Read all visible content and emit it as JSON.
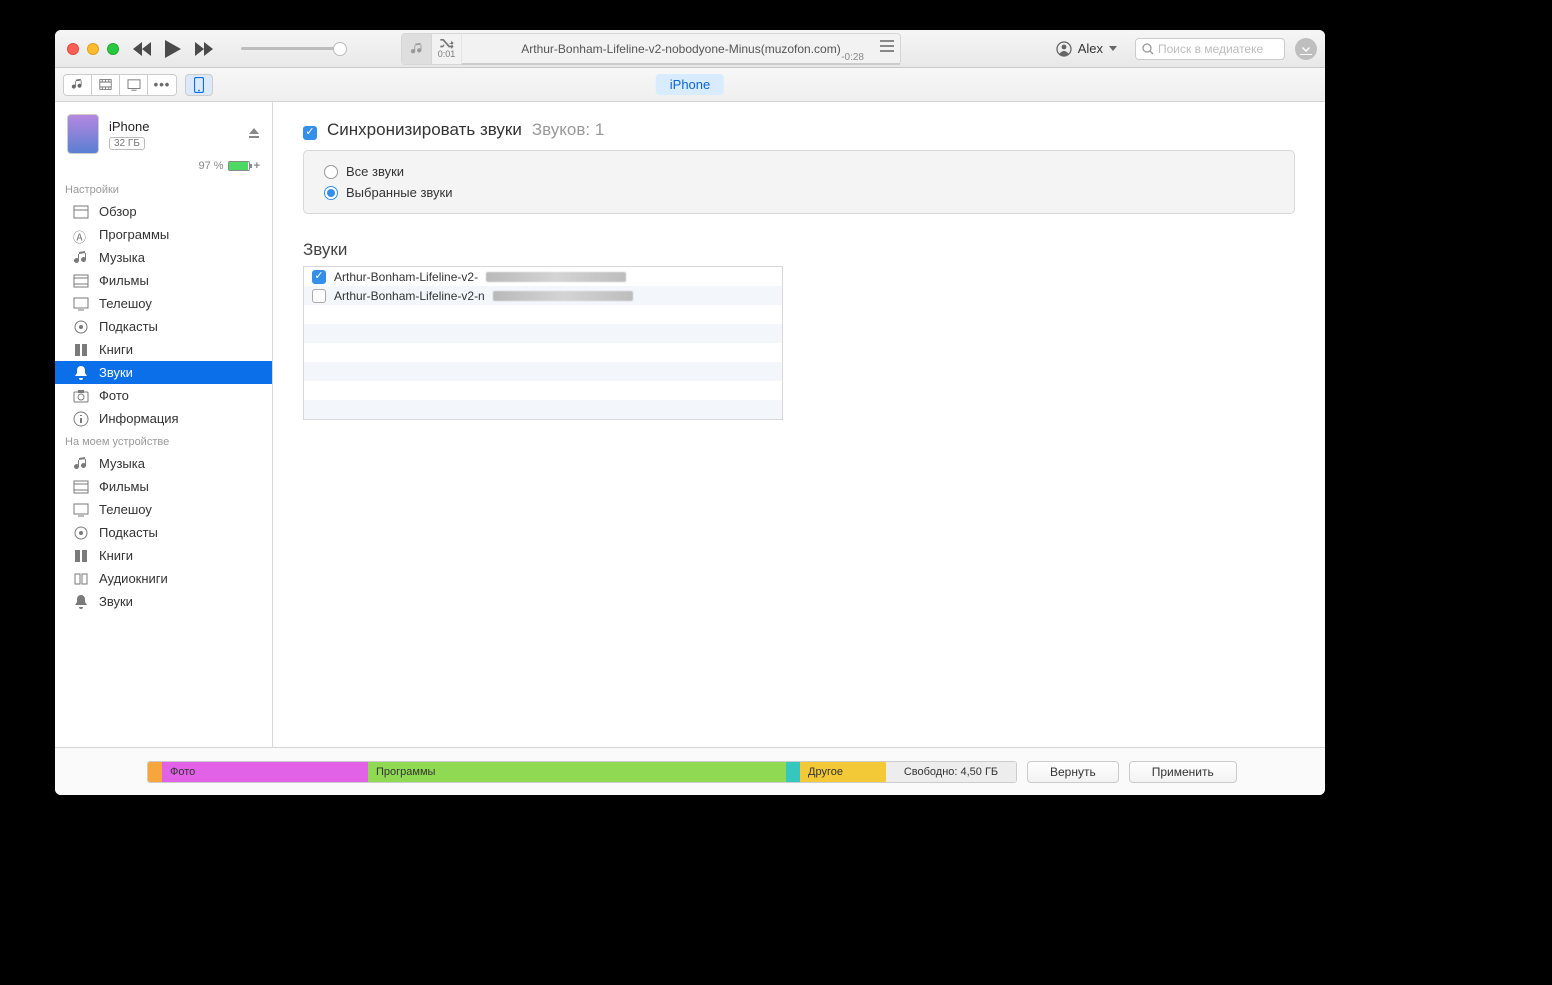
{
  "nowplaying": {
    "title": "Arthur-Bonham-Lifeline-v2-nobodyone-Minus(muzofon.com)",
    "time_elapsed": "0:01",
    "time_remaining": "-0:28"
  },
  "account": {
    "user": "Alex"
  },
  "search": {
    "placeholder": "Поиск в медиатеке"
  },
  "toolbar": {
    "tab": "iPhone"
  },
  "device": {
    "name": "iPhone",
    "capacity": "32 ГБ",
    "battery": "97 %"
  },
  "sidebar": {
    "section_settings": "Настройки",
    "section_device": "На моем устройстве",
    "settings": [
      {
        "label": "Обзор"
      },
      {
        "label": "Программы"
      },
      {
        "label": "Музыка"
      },
      {
        "label": "Фильмы"
      },
      {
        "label": "Телешоу"
      },
      {
        "label": "Подкасты"
      },
      {
        "label": "Книги"
      },
      {
        "label": "Звуки"
      },
      {
        "label": "Фото"
      },
      {
        "label": "Информация"
      }
    ],
    "ondevice": [
      {
        "label": "Музыка"
      },
      {
        "label": "Фильмы"
      },
      {
        "label": "Телешоу"
      },
      {
        "label": "Подкасты"
      },
      {
        "label": "Книги"
      },
      {
        "label": "Аудиокниги"
      },
      {
        "label": "Звуки"
      }
    ]
  },
  "main": {
    "sync_title": "Синхронизировать звуки",
    "count_label": "Звуков: 1",
    "opt_all": "Все звуки",
    "opt_selected": "Выбранные звуки",
    "list_header": "Звуки",
    "items": [
      {
        "label": "Arthur-Bonham-Lifeline-v2-",
        "checked": true
      },
      {
        "label": "Arthur-Bonham-Lifeline-v2-n",
        "checked": false
      }
    ]
  },
  "footer": {
    "photo": "Фото",
    "programs": "Программы",
    "other": "Другое",
    "free": "Свободно: 4,50 ГБ",
    "revert": "Вернуть",
    "apply": "Применить"
  }
}
